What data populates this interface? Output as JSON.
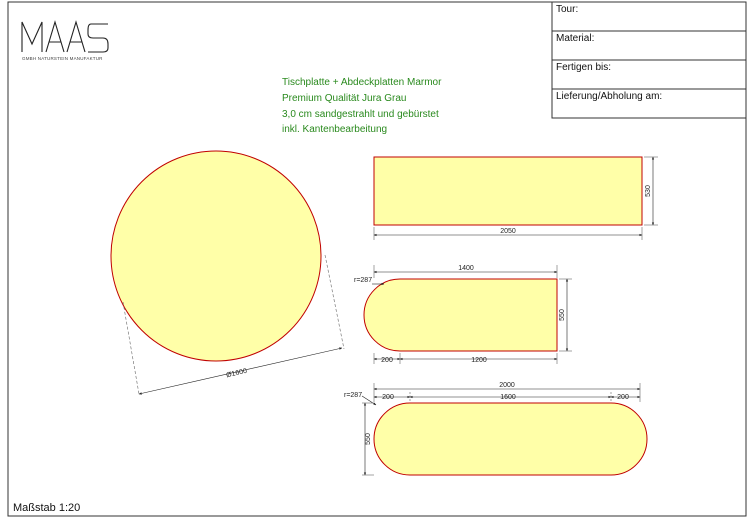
{
  "logo": {
    "name": "MAAS",
    "subtitle": "GMBH NATURSTEIN MANUFAKTUR"
  },
  "info_box": {
    "fields": [
      "Tour:",
      "Material:",
      "Fertigen bis:",
      "Lieferung/Abholung am:"
    ]
  },
  "notes": [
    "Tischplatte + Abdeckplatten Marmor",
    "Premium Qualität Jura Grau",
    "3,0 cm sandgestrahlt und gebürstet",
    "inkl. Kantenbearbeitung"
  ],
  "scale": "Maßstab 1:20",
  "colors": {
    "fill": "#ffffa8",
    "outline": "#c00000",
    "note_text": "#2a8a1e",
    "dimension": "#222222",
    "frame": "#333333"
  },
  "parts": {
    "round_table": {
      "diameter_label": "Ø1600"
    },
    "rectangle": {
      "length_label": "2050",
      "width_label": "530"
    },
    "half_round": {
      "top_label": "1400",
      "radius_label": "r=287",
      "width_label": "550",
      "left_label": "200",
      "bottom_label": "1200"
    },
    "stadium": {
      "overall_label": "2000",
      "radius_label": "r=287",
      "left_label": "200",
      "middle_label": "1600",
      "right_label": "200",
      "height_label": "550"
    }
  }
}
